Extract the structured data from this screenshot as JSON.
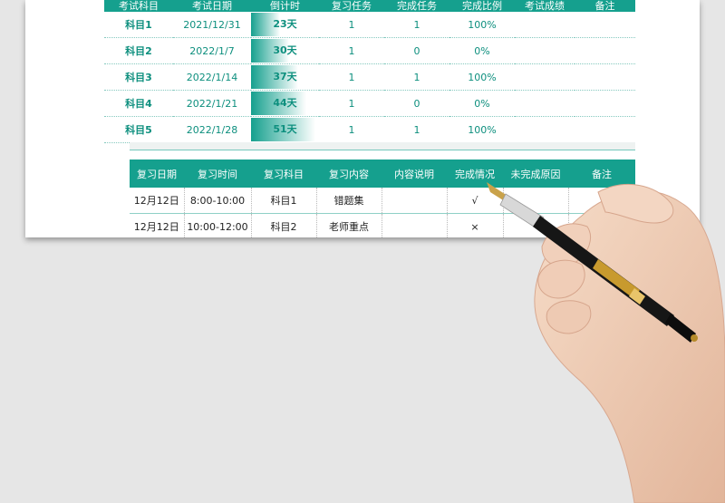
{
  "table1": {
    "headers": [
      "考试科目",
      "考试日期",
      "倒计时",
      "复习任务",
      "完成任务",
      "完成比例",
      "考试成绩",
      "备注"
    ],
    "rows": [
      {
        "subject": "科目1",
        "date": "2021/12/31",
        "countdown": "23天",
        "countdown_days": 23,
        "tasks": "1",
        "done": "1",
        "ratio": "100%"
      },
      {
        "subject": "科目2",
        "date": "2022/1/7",
        "countdown": "30天",
        "countdown_days": 30,
        "tasks": "1",
        "done": "0",
        "ratio": "0%"
      },
      {
        "subject": "科目3",
        "date": "2022/1/14",
        "countdown": "37天",
        "countdown_days": 37,
        "tasks": "1",
        "done": "1",
        "ratio": "100%"
      },
      {
        "subject": "科目4",
        "date": "2022/1/21",
        "countdown": "44天",
        "countdown_days": 44,
        "tasks": "1",
        "done": "0",
        "ratio": "0%"
      },
      {
        "subject": "科目5",
        "date": "2022/1/28",
        "countdown": "51天",
        "countdown_days": 51,
        "tasks": "1",
        "done": "1",
        "ratio": "100%"
      }
    ]
  },
  "table2": {
    "headers": [
      "复习日期",
      "复习时间",
      "复习科目",
      "复习内容",
      "内容说明",
      "完成情况",
      "未完成原因",
      "备注"
    ],
    "rows": [
      {
        "date": "12月12日",
        "time": "8:00-10:00",
        "subject": "科目1",
        "content": "错题集",
        "desc": "",
        "status": "√",
        "reason": "",
        "note": ""
      },
      {
        "date": "12月12日",
        "time": "10:00-12:00",
        "subject": "科目2",
        "content": "老师重点",
        "desc": "",
        "status": "×",
        "reason": "",
        "note": ""
      }
    ]
  },
  "colors": {
    "accent": "#15a08e",
    "text_teal": "#0d8f7e",
    "background": "#e6e6e6"
  },
  "icons": {
    "pen": "fountain-pen-icon",
    "hand": "hand-holding-pen"
  }
}
